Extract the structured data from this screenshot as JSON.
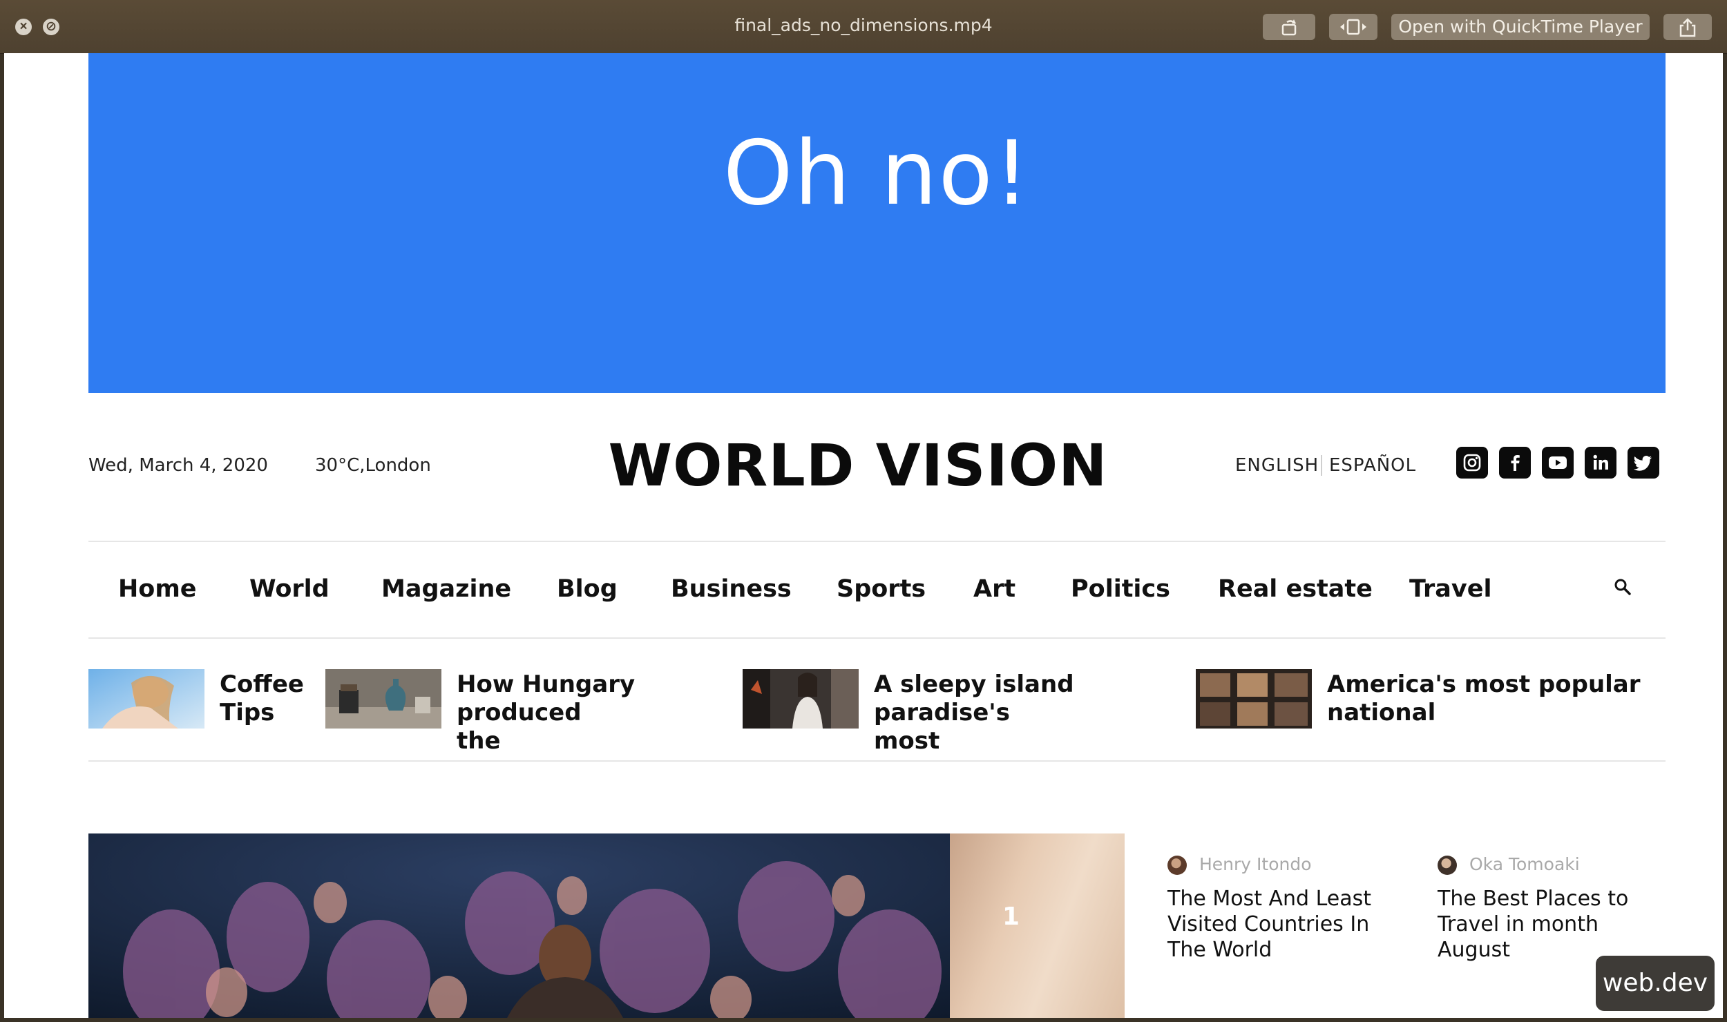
{
  "window": {
    "title": "final_ads_no_dimensions.mp4",
    "open_with_label": "Open with QuickTime Player"
  },
  "ad": {
    "text": "Oh no!"
  },
  "header": {
    "date": "Wed, March 4, 2020",
    "weather": "30°C,London",
    "logo": "WORLD VISION",
    "languages": [
      "ENGLISH",
      "ESPAÑOL"
    ],
    "social_icons": [
      "instagram-icon",
      "facebook-icon",
      "youtube-icon",
      "linkedin-icon",
      "twitter-icon"
    ]
  },
  "nav": {
    "items": [
      "Home",
      "World",
      "Magazine",
      "Blog",
      "Business",
      "Sports",
      "Art",
      "Politics",
      "Real estate",
      "Travel"
    ]
  },
  "stories": [
    {
      "headline_l1": "Coffee",
      "headline_l2": "Tips"
    },
    {
      "headline_l1": "How Hungary produced",
      "headline_l2": "the"
    },
    {
      "headline_l1": "A sleepy island paradise's",
      "headline_l2": "most"
    },
    {
      "headline_l1": "America's most popular",
      "headline_l2": "national"
    }
  ],
  "hero": {
    "slide_number": "1"
  },
  "cards": [
    {
      "author": "Henry Itondo",
      "title_l1": "The Most And Least",
      "title_l2": "Visited Countries In",
      "title_l3": "The World"
    },
    {
      "author": "Oka Tomoaki",
      "title_l1": "The Best Places to",
      "title_l2": "Travel in month",
      "title_l3": "August"
    }
  ],
  "badge": {
    "text": "web.dev"
  },
  "colors": {
    "ad_blue": "#2f7cf2",
    "titlebar": "#4e4130"
  }
}
